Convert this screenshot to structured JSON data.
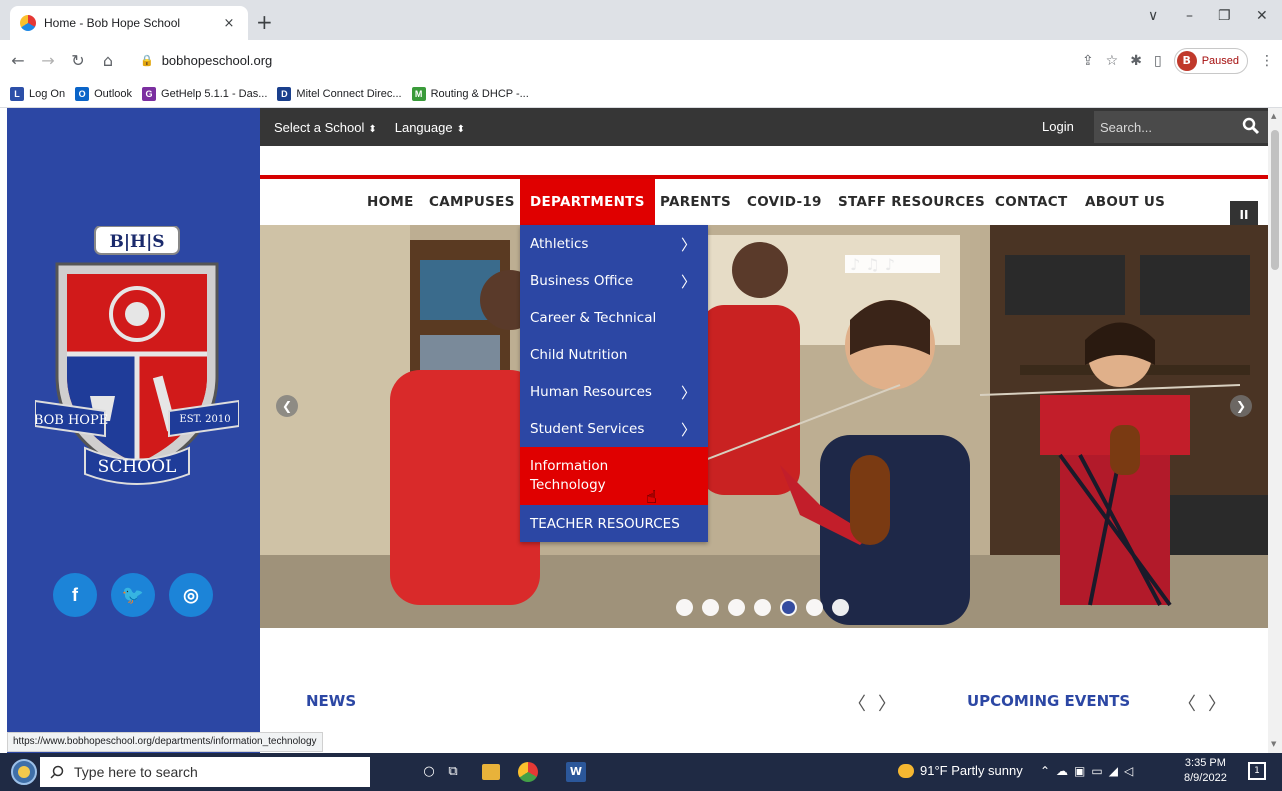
{
  "browser": {
    "tab_title": "Home - Bob Hope School",
    "tab_close": "×",
    "new_tab": "+",
    "url": "bobhopeschool.org",
    "profile_initial": "B",
    "profile_status": "Paused",
    "window_controls": [
      "∨",
      "–",
      "❐",
      "✕"
    ],
    "bookmarks": [
      {
        "label": "Log On",
        "icon": "log-on-icon",
        "color": "#2c4fa8"
      },
      {
        "label": "Outlook",
        "icon": "outlook-icon",
        "color": "#0a64c8"
      },
      {
        "label": "GetHelp 5.1.1 - Das...",
        "icon": "gethelp-icon",
        "color": "#7b2fa0"
      },
      {
        "label": "Mitel Connect Direc...",
        "icon": "mitel-icon",
        "color": "#1a3f8c"
      },
      {
        "label": "Routing & DHCP -...",
        "icon": "routing-icon",
        "color": "#3a9b3a"
      }
    ]
  },
  "site": {
    "topbar": {
      "select_school": "Select a School",
      "language": "Language",
      "login": "Login",
      "search_placeholder": "Search..."
    },
    "nav": [
      "HOME",
      "CAMPUSES",
      "DEPARTMENTS",
      "PARENTS",
      "COVID-19",
      "STAFF RESOURCES",
      "CONTACT",
      "ABOUT US"
    ],
    "nav_active": "DEPARTMENTS",
    "departments_menu": [
      {
        "label": "Athletics",
        "submenu": true
      },
      {
        "label": "Business Office",
        "submenu": true
      },
      {
        "label": "Career & Technical",
        "submenu": false
      },
      {
        "label": "Child Nutrition",
        "submenu": false
      },
      {
        "label": "Human Resources",
        "submenu": true
      },
      {
        "label": "Student Services",
        "submenu": true
      },
      {
        "label": "Information Technology",
        "submenu": false,
        "active": true
      },
      {
        "label": "TEACHER RESOURCES",
        "submenu": false
      }
    ],
    "crest": {
      "monogram": "B|H|S",
      "banner_left": "BOB HOPE",
      "banner_right": "EST. 2010",
      "banner_bottom": "SCHOOL"
    },
    "social": [
      {
        "label": "f",
        "icon": "facebook-icon"
      },
      {
        "label": "🐦",
        "icon": "twitter-icon"
      },
      {
        "label": "◎",
        "icon": "instagram-icon"
      }
    ],
    "slider": {
      "slides": 7,
      "active_index": 4,
      "pause_label": "II"
    },
    "sections": {
      "news": "NEWS",
      "events": "UPCOMING EVENTS"
    },
    "status_url": "https://www.bobhopeschool.org/departments/information_technology"
  },
  "taskbar": {
    "search_text": "Type here to search",
    "weather": "91°F  Partly sunny",
    "time": "3:35 PM",
    "date": "8/9/2022"
  },
  "colors": {
    "brand_blue": "#2c47a4",
    "brand_red": "#e00000",
    "topbar": "#363636"
  }
}
